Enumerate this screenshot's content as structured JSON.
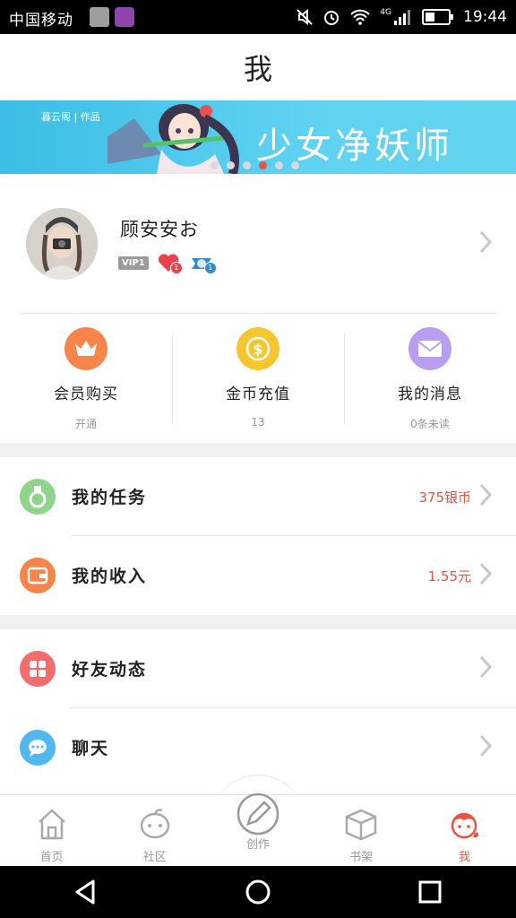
{
  "status_bar": {
    "carrier": "中国移动",
    "time": "19:44",
    "network": "4G"
  },
  "header": {
    "title": "我"
  },
  "banner": {
    "studio_label": "暮云阁 | 作品",
    "title": "少女净妖师",
    "slide_count": 6,
    "active_slide": 4
  },
  "profile": {
    "username": "顾安安お",
    "vip_label": "VIP1",
    "like_count": "1",
    "badge_count": "1"
  },
  "quick_actions": [
    {
      "label": "会员购买",
      "sub": "开通",
      "color": "#f7854a",
      "icon": "crown-icon"
    },
    {
      "label": "金币充值",
      "sub": "13",
      "color": "#f7c62f",
      "icon": "coin-icon"
    },
    {
      "label": "我的消息",
      "sub": "0条未读",
      "color": "#b89df0",
      "icon": "mail-icon"
    }
  ],
  "menu_group1": [
    {
      "label": "我的任务",
      "value": "375银币",
      "color": "#7fd17a",
      "icon": "medal-icon"
    },
    {
      "label": "我的收入",
      "value": "1.55元",
      "color": "#f7854a",
      "icon": "wallet-icon"
    }
  ],
  "menu_group2": [
    {
      "label": "好友动态",
      "value": "",
      "color": "#f26d6d",
      "icon": "grid-icon"
    },
    {
      "label": "聊天",
      "value": "",
      "color": "#4fb8ef",
      "icon": "chat-icon"
    }
  ],
  "tabs": [
    {
      "label": "首页",
      "icon": "home-icon",
      "active": false
    },
    {
      "label": "社区",
      "icon": "community-icon",
      "active": false
    },
    {
      "label": "创作",
      "icon": "pen-icon",
      "active": false
    },
    {
      "label": "书架",
      "icon": "bookshelf-icon",
      "active": false
    },
    {
      "label": "我",
      "icon": "me-icon",
      "active": true
    }
  ],
  "colors": {
    "accent": "#e8543f",
    "banner": "#4cc9ee"
  }
}
